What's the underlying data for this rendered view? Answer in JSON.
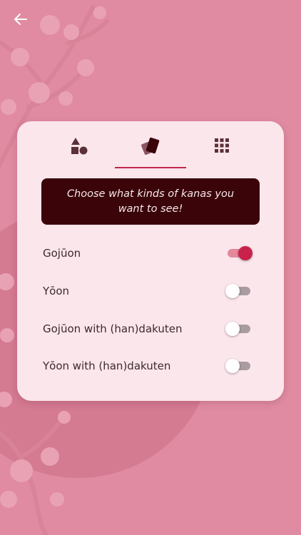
{
  "colors": {
    "background": "#e08ba1",
    "sun": "#d47a91",
    "card": "#fbe6ec",
    "accent": "#c1274b",
    "banner": "#3a0409",
    "icon_color": "#5c3038",
    "toggle_off_track": "#a99ca0"
  },
  "header": {
    "back_icon": "arrow-left-icon"
  },
  "tabs": [
    {
      "icon": "shapes-icon",
      "selected": false
    },
    {
      "icon": "cards-icon",
      "selected": true
    },
    {
      "icon": "grid-icon",
      "selected": false
    }
  ],
  "banner": {
    "text": "Choose what kinds of kanas you want to see!"
  },
  "options": [
    {
      "label": "Gojūon",
      "enabled": true
    },
    {
      "label": "Yōon",
      "enabled": false
    },
    {
      "label": "Gojūon with (han)dakuten",
      "enabled": false
    },
    {
      "label": "Yōon with (han)dakuten",
      "enabled": false
    }
  ]
}
